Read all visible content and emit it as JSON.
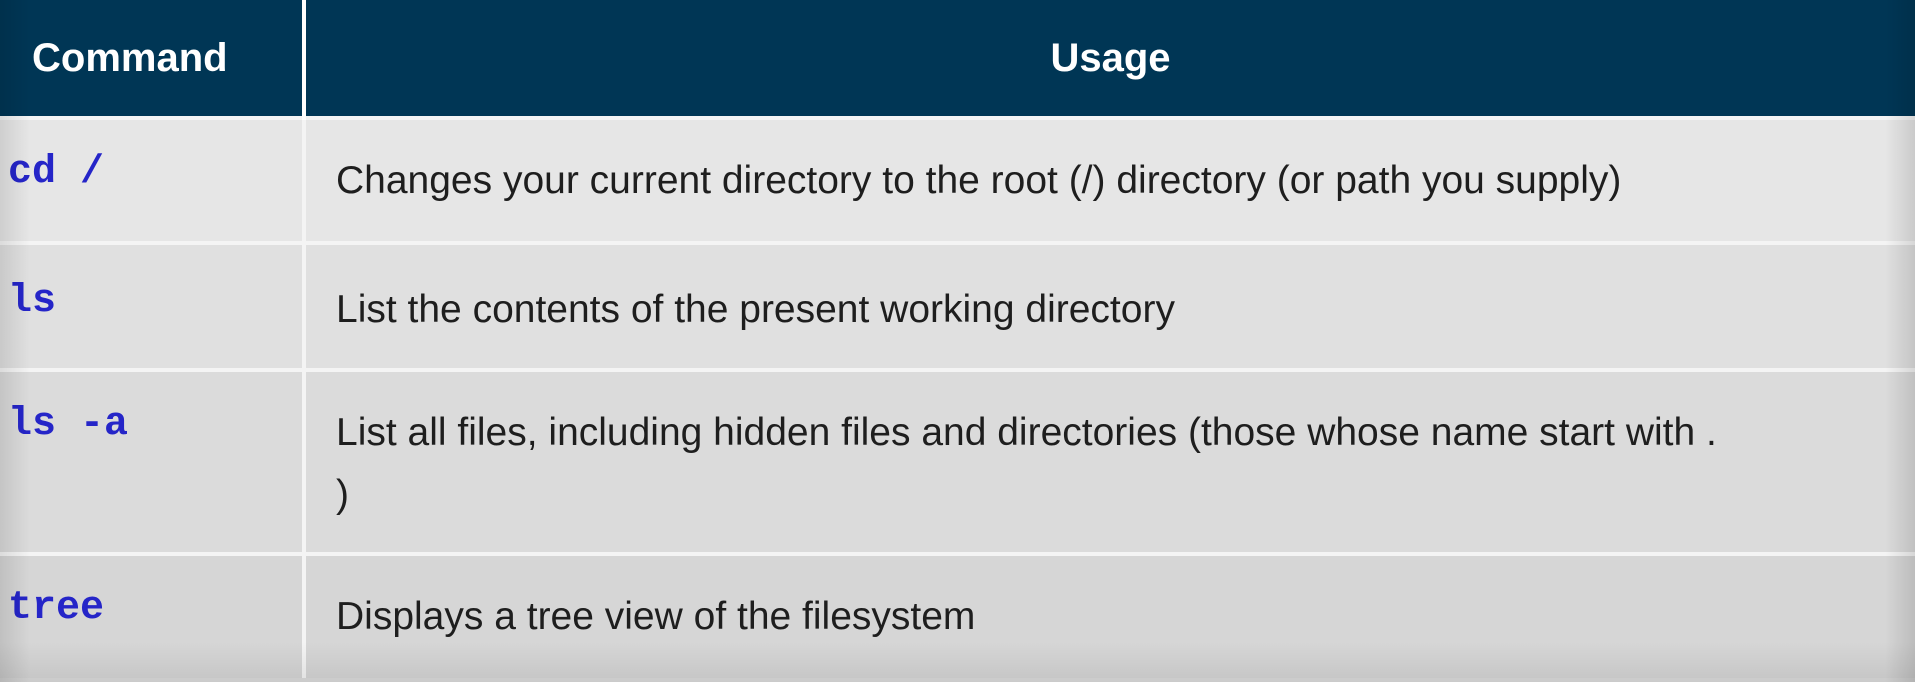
{
  "table": {
    "headers": {
      "command": "Command",
      "usage": "Usage"
    },
    "rows": [
      {
        "command": "cd /",
        "usage_lines": [
          "Changes your current directory to the root (/) directory (or path you supply)"
        ]
      },
      {
        "command": "ls",
        "usage_lines": [
          "List the contents of the present working directory"
        ]
      },
      {
        "command": "ls -a",
        "usage_lines": [
          "List all files, including hidden files and directories (those whose name start with .",
          ")"
        ]
      },
      {
        "command": "tree",
        "usage_lines": [
          "Displays a tree view of the filesystem"
        ]
      }
    ]
  },
  "colors": {
    "header_background": "#003655",
    "header_text": "#ffffff",
    "command_text": "#2525c8",
    "body_text": "#1e1e1e",
    "row_background": "#e0e0e0"
  }
}
